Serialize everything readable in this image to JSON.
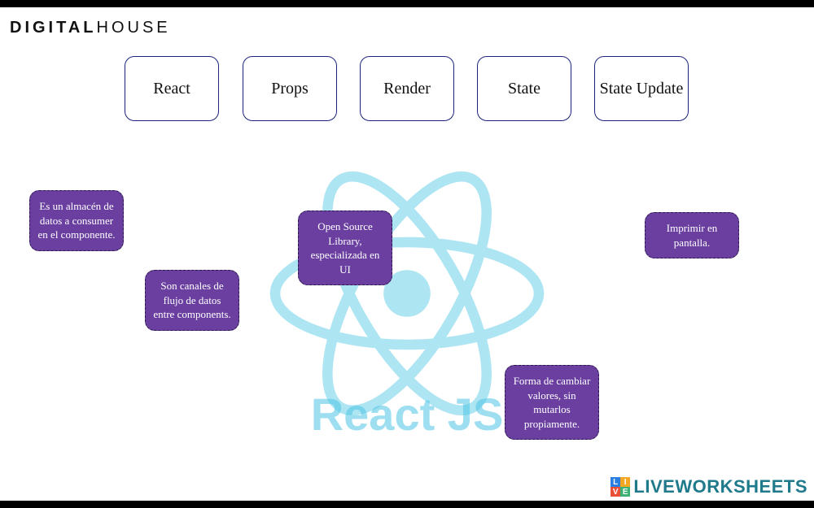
{
  "brand": {
    "part1": "DIGITAL",
    "part2": "HOUSE"
  },
  "dropzones": [
    {
      "label": "React"
    },
    {
      "label": "Props"
    },
    {
      "label": "Render"
    },
    {
      "label": "State"
    },
    {
      "label": "State Update"
    }
  ],
  "cards": [
    {
      "text": "Es un almacén de datos a consumer en el componente."
    },
    {
      "text": "Son canales de flujo de datos entre components."
    },
    {
      "text": "Open Source Library, especializada en UI"
    },
    {
      "text": "Forma de cambiar valores, sin mutarlos propiamente."
    },
    {
      "text": "Imprimir en pantalla."
    }
  ],
  "watermark": {
    "text": "React JS"
  },
  "footer": {
    "brand": "LIVEWORKSHEETS",
    "badge": [
      "L",
      "I",
      "V",
      "E"
    ]
  }
}
